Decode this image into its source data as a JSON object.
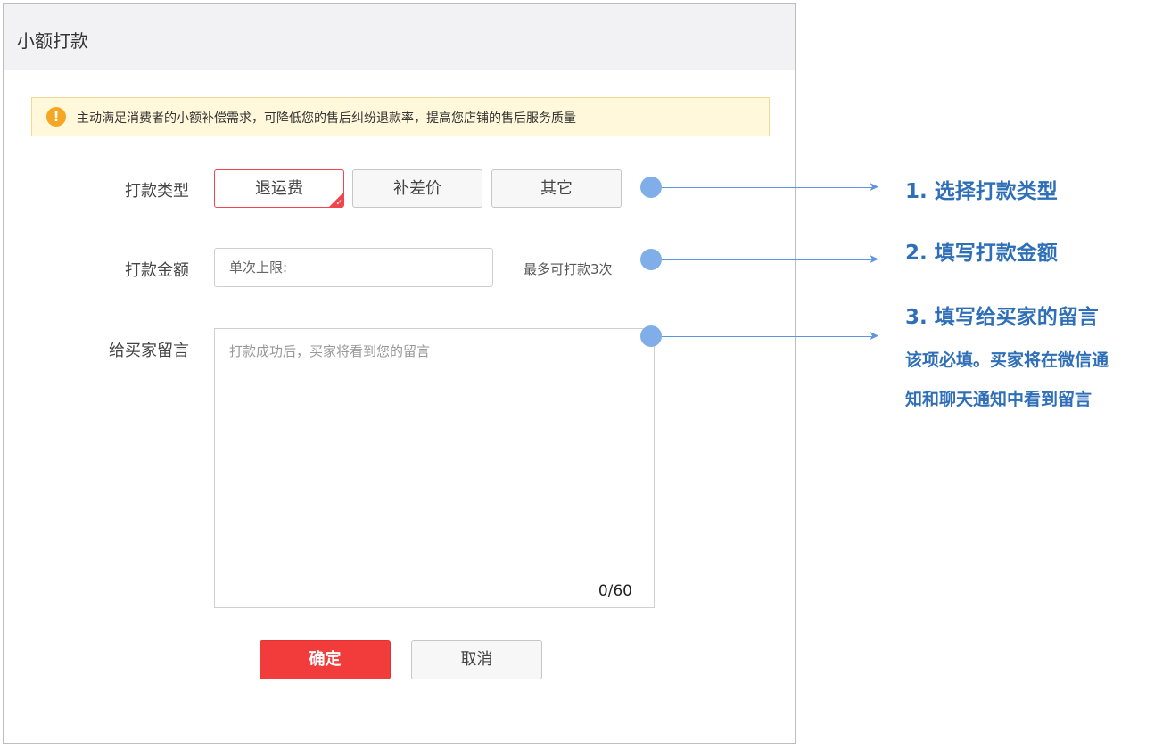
{
  "dialog": {
    "title": "小额打款",
    "notice_icon": "!",
    "notice_text": "主动满足消费者的小额补偿需求，可降低您的售后纠纷退款率，提高您店铺的售后服务质量"
  },
  "form": {
    "type_label": "打款类型",
    "type_options": [
      "退运费",
      "补差价",
      "其它"
    ],
    "type_selected": "退运费",
    "amount_label": "打款金额",
    "amount_placeholder": "单次上限:",
    "amount_value": "",
    "amount_hint": "最多可打款3次",
    "message_label": "给买家留言",
    "message_placeholder": "打款成功后，买家将看到您的留言",
    "message_value": "",
    "message_count": "0/60"
  },
  "actions": {
    "confirm_label": "确定",
    "cancel_label": "取消"
  },
  "annotations": {
    "step1": "1. 选择打款类型",
    "step2": "2. 填写打款金额",
    "step3": "3. 填写给买家的留言",
    "step3_desc_line1": "该项必填。买家将在微信通",
    "step3_desc_line2": "知和聊天通知中看到留言"
  },
  "colors": {
    "accent_red": "#f0444e",
    "annotation_blue": "#2f6fb7",
    "notice_bg": "#fff8da"
  },
  "icons": {
    "notice": "warning-circle-icon",
    "selected_corner": "check-corner-icon"
  }
}
